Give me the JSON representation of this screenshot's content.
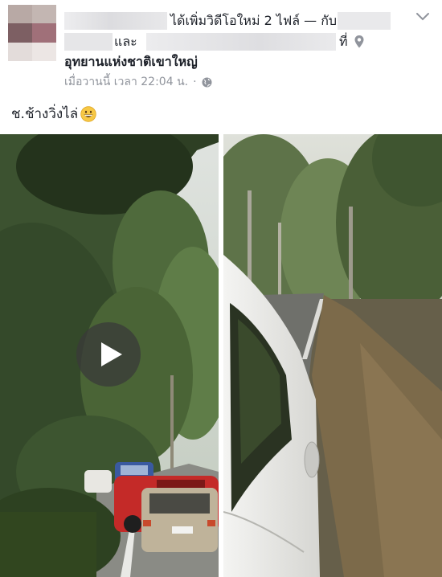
{
  "post": {
    "headline": "ได้เพิ่มวิดีโอใหม่ 2 ไฟล์ — กับ",
    "with_word": "และ",
    "at_word": "ที่",
    "place": "อุทยานแห่งชาติเขาใหญ่",
    "timestamp": "เมื่อวานนี้ เวลา 22:04 น.",
    "separator": "·",
    "caption": "ช.ช้างวิ่งไล่",
    "caption_emoji": "grinning-face-emoji",
    "privacy_icon": "globe-icon",
    "location_icon": "map-pin-icon",
    "menu_icon": "chevron-down-icon",
    "play_icon": "play-icon",
    "videos_count": 2
  },
  "colors": {
    "text": "#1d2129",
    "meta": "#90949c",
    "redacted": "#e4e4e6",
    "overlay": "#3a3a3a"
  }
}
